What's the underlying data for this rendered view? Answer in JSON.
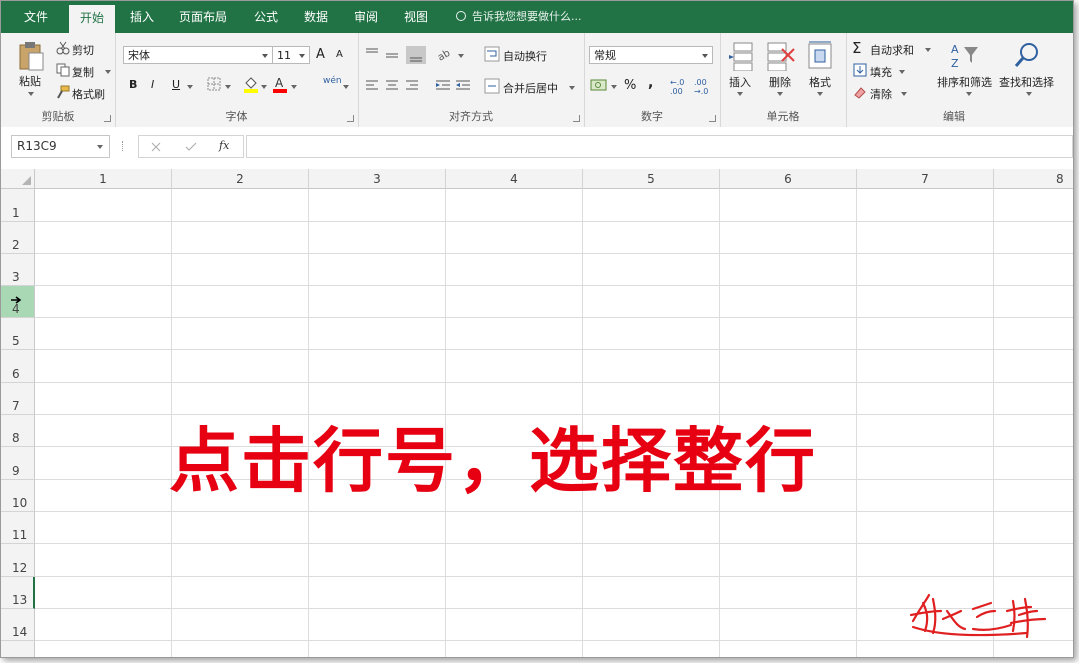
{
  "ribbon_tabs": [
    {
      "label": "文件",
      "active": false
    },
    {
      "label": "开始",
      "active": true
    },
    {
      "label": "插入",
      "active": false
    },
    {
      "label": "页面布局",
      "active": false
    },
    {
      "label": "公式",
      "active": false
    },
    {
      "label": "数据",
      "active": false
    },
    {
      "label": "审阅",
      "active": false
    },
    {
      "label": "视图",
      "active": false
    }
  ],
  "tell_me": "告诉我您想要做什么...",
  "clipboard": {
    "paste": "粘贴",
    "cut": "剪切",
    "copy": "复制",
    "format_painter": "格式刷",
    "group": "剪贴板"
  },
  "font": {
    "name": "宋体",
    "size": "11",
    "bold": "B",
    "italic": "I",
    "underline": "U",
    "grow": "A",
    "shrink": "A",
    "fill_color": "#ffff00",
    "font_color": "#ff0000",
    "phonetic": "wén",
    "group": "字体"
  },
  "alignment": {
    "wrap": "自动换行",
    "merge": "合并后居中",
    "group": "对齐方式"
  },
  "number": {
    "format": "常规",
    "percent": "%",
    "comma": ",",
    "inc_dec": "←.0 .00",
    "dec_dec": ".00 →.0",
    "group": "数字"
  },
  "cells": {
    "insert": "插入",
    "delete": "删除",
    "format": "格式",
    "group": "单元格"
  },
  "editing": {
    "autosum": "自动求和",
    "fill": "填充",
    "clear": "清除",
    "sort": "排序和筛选",
    "find": "查找和选择",
    "group": "编辑"
  },
  "formula_bar": {
    "name_box": "R13C9",
    "fx": "fx",
    "content": ""
  },
  "columns": [
    "1",
    "2",
    "3",
    "4",
    "5",
    "6",
    "7",
    "8"
  ],
  "rows": [
    "1",
    "2",
    "3",
    "4",
    "5",
    "6",
    "7",
    "8",
    "9",
    "10",
    "11",
    "12",
    "13",
    "14"
  ],
  "hovered_row": "4",
  "active_row": "13",
  "overlay_text": "点击行号，选择整行",
  "signature": "魏之峰",
  "colors": {
    "brand_green": "#217346",
    "overlay_red": "#e60012",
    "selected_row_header": "#a9d8b5"
  }
}
